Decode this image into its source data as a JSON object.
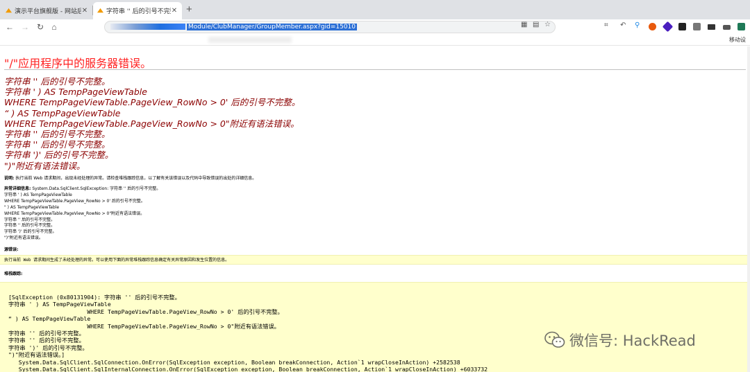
{
  "browser": {
    "tabs": [
      {
        "title": "演示平台旗舰版 - 网站后台管理",
        "active": false
      },
      {
        "title": "字符串 '' 后的引号不完整。<b",
        "active": true
      }
    ],
    "url_path": "Module/ClubManager/GroupMember.aspx?gid=15010",
    "mobile_label": "移动设"
  },
  "page": {
    "title": "\"/\"应用程序中的服务器错误。",
    "error_lines": [
      "字符串 '' 后的引号不完整。",
      "字符串 ' ) AS TempPageViewTable",
      "WHERE TempPageViewTable.PageView_RowNo > 0' 后的引号不完整。",
      "“ ) AS TempPageViewTable",
      "WHERE TempPageViewTable.PageView_RowNo > 0\"附近有语法错误。",
      "字符串 '' 后的引号不完整。",
      "字符串 '' 后的引号不完整。",
      "字符串 ')' 后的引号不完整。",
      "\")\"附近有语法错误。"
    ],
    "description_label": "说明:",
    "description_text": "执行当前 Web 请求期间，出现未经处理的异常。请检查堆栈跟踪信息，以了解有关该错误以及代码中导致错误的出处的详细信息。",
    "exception_label": "异常详细信息:",
    "exception_head": "System.Data.SqlClient.SqlException: 字符串 '' 后的引号不完整。",
    "exception_lines": [
      "字符串 ' ) AS TempPageViewTable",
      "WHERE TempPageViewTable.PageView_RowNo > 0' 后的引号不完整。",
      "\" ) AS TempPageViewTable",
      "WHERE TempPageViewTable.PageView_RowNo > 0\"附近有语法错误。",
      "字符串 '' 后的引号不完整。",
      "字符串 '' 后的引号不完整。",
      "字符串 ')' 后的引号不完整。",
      "\")\"附近有语法错误。"
    ],
    "source_error_label": "源错误:",
    "source_error_text": "执行当前 Web 请求期间生成了未经处理的异常。可以使用下面的异常堆栈跟踪信息确定有关异常原因和发生位置的信息。",
    "stack_label": "堆栈跟踪:",
    "stack_text": "[SqlException (0x80131904): 字符串 '' 后的引号不完整。\n字符串 ' ) AS TempPageViewTable\n                       WHERE TempPageViewTable.PageView_RowNo > 0' 后的引号不完整。\n“ ) AS TempPageViewTable\n                       WHERE TempPageViewTable.PageView_RowNo > 0\"附近有语法错误。\n字符串 '' 后的引号不完整。\n字符串 '' 后的引号不完整。\n字符串 ')' 后的引号不完整。\n\")\"附近有语法错误。]\n   System.Data.SqlClient.SqlConnection.OnError(SqlException exception, Boolean breakConnection, Action`1 wrapCloseInAction) +2582538\n   System.Data.SqlClient.SqlInternalConnection.OnError(SqlException exception, Boolean breakConnection, Action`1 wrapCloseInAction) +6033732"
  },
  "watermark": {
    "text": "微信号: HackRead"
  },
  "colors": {
    "error_red": "#ff2222",
    "error_dark": "#8b0000",
    "highlight_yellow": "#ffffcc"
  }
}
